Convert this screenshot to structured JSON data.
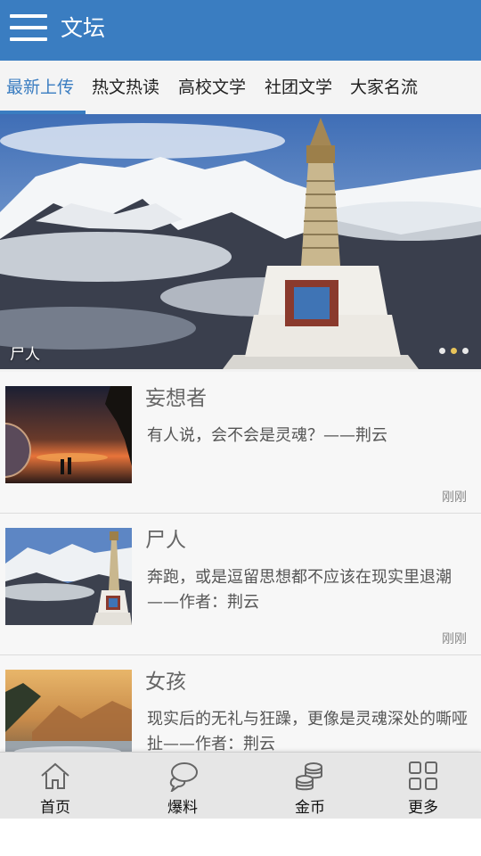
{
  "header": {
    "title": "文坛",
    "menu_icon": "hamburger-menu-icon"
  },
  "tabs": [
    {
      "label": "最新上传",
      "active": true
    },
    {
      "label": "热文热读",
      "active": false
    },
    {
      "label": "高校文学",
      "active": false
    },
    {
      "label": "社团文学",
      "active": false
    },
    {
      "label": "大家名流",
      "active": false
    }
  ],
  "banner": {
    "caption": "尸人",
    "slides": 3,
    "current_slide": 2
  },
  "articles": [
    {
      "title": "妄想者",
      "summary": "有人说，会不会是灵魂？——荆云",
      "time": "刚刚"
    },
    {
      "title": "尸人",
      "summary": "奔跑，或是逗留思想都不应该在现实里退潮——作者：荆云",
      "time": "刚刚"
    },
    {
      "title": "女孩",
      "summary": "现实后的无礼与狂躁，更像是灵魂深处的嘶哑扯——作者：荆云",
      "time": ""
    }
  ],
  "bottom_nav": [
    {
      "label": "首页",
      "icon": "home-icon"
    },
    {
      "label": "爆料",
      "icon": "chat-bubble-icon"
    },
    {
      "label": "金币",
      "icon": "coins-icon"
    },
    {
      "label": "更多",
      "icon": "grid-icon"
    }
  ],
  "colors": {
    "header_bg": "#3a7dc1",
    "accent": "#3a7dc1",
    "indicator_active": "#e8c45a"
  }
}
